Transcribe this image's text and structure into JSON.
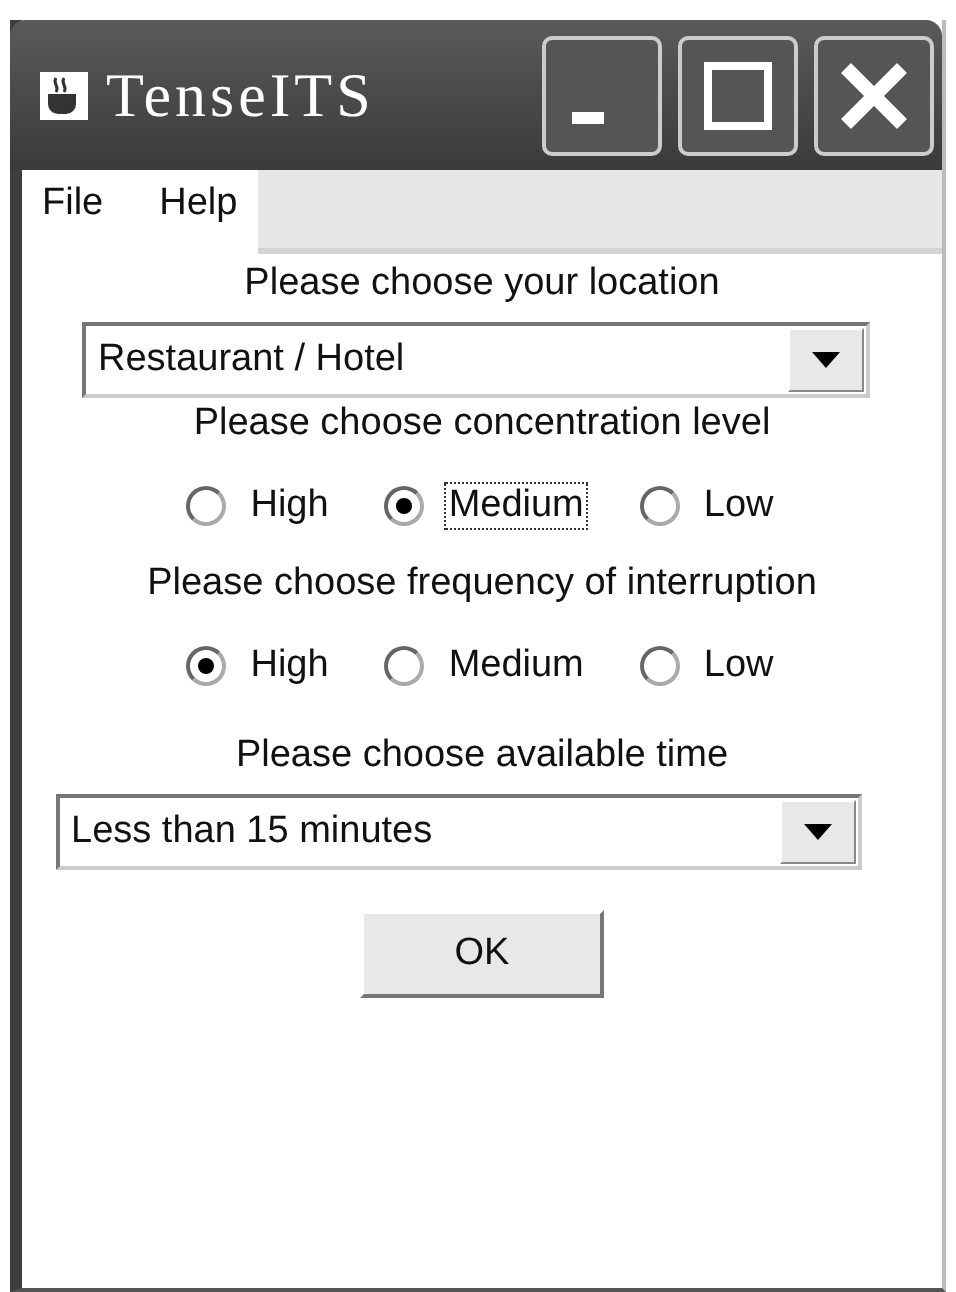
{
  "window": {
    "title": "TenseITS",
    "controls": [
      {
        "kind": "minimize"
      },
      {
        "kind": "maximize"
      },
      {
        "kind": "close"
      }
    ]
  },
  "menu": [
    {
      "label": "File"
    },
    {
      "label": "Help"
    }
  ],
  "sections": [
    {
      "kind": "dropdown",
      "label": "Please choose your location",
      "value": "Restaurant / Hotel",
      "wide": false
    },
    {
      "kind": "radio",
      "label": "Please choose concentration level",
      "options": [
        {
          "label": "High",
          "selected": false,
          "focused": false
        },
        {
          "label": "Medium",
          "selected": true,
          "focused": true
        },
        {
          "label": "Low",
          "selected": false,
          "focused": false
        }
      ]
    },
    {
      "kind": "radio",
      "label": "Please choose frequency of interruption",
      "options": [
        {
          "label": "High",
          "selected": true,
          "focused": false
        },
        {
          "label": "Medium",
          "selected": false,
          "focused": false
        },
        {
          "label": "Low",
          "selected": false,
          "focused": false
        }
      ]
    },
    {
      "kind": "dropdown",
      "label": "Please choose available time",
      "value": "Less than 15 minutes",
      "wide": true
    }
  ],
  "ok_button": {
    "label": "OK"
  }
}
